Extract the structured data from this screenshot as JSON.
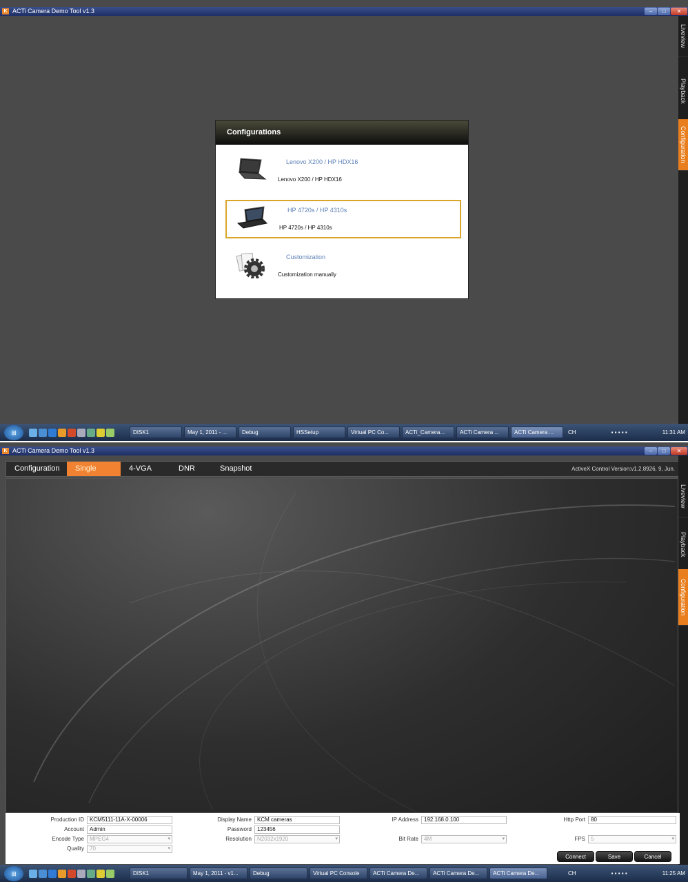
{
  "screen1": {
    "title": "ACTi Camera Demo Tool v1.3",
    "side_tabs": [
      "Liveview",
      "Playback",
      "Configuration"
    ],
    "dialog": {
      "title": "Configurations",
      "options": [
        {
          "title": "Lenovo X200 / HP HDX16",
          "desc": "Lenovo X200 / HP HDX16",
          "icon": "laptop-icon",
          "selected": false
        },
        {
          "title": "HP 4720s / HP 4310s",
          "desc": "HP 4720s / HP 4310s",
          "icon": "laptop-icon",
          "selected": true
        },
        {
          "title": "Customization",
          "desc": "Customization manually",
          "icon": "gear-icon",
          "selected": false
        }
      ]
    },
    "taskbar": {
      "tasks": [
        "DISK1",
        "May 1, 2011 - ...",
        "Debug",
        "HSSetup",
        "Virtual PC Co...",
        "ACTi_Camera...",
        "ACTi Camera ...",
        "ACTi Camera ..."
      ],
      "tray_lang": "CH",
      "clock": "11:31 AM"
    }
  },
  "screen2": {
    "title": "ACTi Camera Demo Tool v1.3",
    "side_tabs": [
      "Liveview",
      "Playback",
      "Configuration"
    ],
    "nav": {
      "tabs": [
        "Configuration",
        "Single View",
        "4-VGA",
        "DNR",
        "Snapshot"
      ],
      "active": "Single View",
      "version": "ActiveX Control Version:v1.2.8926, 9, Jun."
    },
    "form": {
      "production_id": {
        "label": "Production ID",
        "value": "KCM5111-11A-X-00006"
      },
      "account": {
        "label": "Account",
        "value": "Admin"
      },
      "encode_type": {
        "label": "Encode Type",
        "value": "MPEG4"
      },
      "quality": {
        "label": "Quality",
        "value": "70"
      },
      "display_name": {
        "label": "Display Name",
        "value": "KCM cameras"
      },
      "password": {
        "label": "Password",
        "value": "123456"
      },
      "resolution": {
        "label": "Resolution",
        "value": "N2032x1920"
      },
      "ip_address": {
        "label": "IP Address",
        "value": "192.168.0.100"
      },
      "bit_rate": {
        "label": "Bit Rate",
        "value": "4M"
      },
      "http_port": {
        "label": "Http Port",
        "value": "80"
      },
      "fps": {
        "label": "FPS",
        "value": "5"
      },
      "buttons": {
        "connect": "Connect",
        "save": "Save",
        "cancel": "Cancel"
      }
    },
    "taskbar": {
      "tasks": [
        "DISK1",
        "May 1, 2011 - v1...",
        "Debug",
        "Virtual PC Console",
        "ACTi Camera De...",
        "ACTi Camera De...",
        "ACTi Camera De..."
      ],
      "tray_lang": "CH",
      "clock": "11:25 AM"
    }
  },
  "colors": {
    "accent": "#f08232",
    "option_title": "#5b7fb6",
    "selected_border": "#d9a62a"
  }
}
